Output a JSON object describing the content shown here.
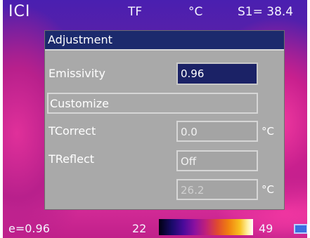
{
  "top_bar": {
    "brand": "ICI",
    "mode": "TF",
    "unit": "°C",
    "spot": "S1= 38.4"
  },
  "panel": {
    "title": "Adjustment",
    "emissivity": {
      "label": "Emissivity",
      "value": "0.96"
    },
    "customize": {
      "label": "Customize"
    },
    "tcorrect": {
      "label": "TCorrect",
      "value": "0.0",
      "unit": "°C"
    },
    "treflect": {
      "label": "TReflect",
      "value": "Off",
      "temp_value": "26.2",
      "unit": "°C"
    }
  },
  "bottom_bar": {
    "emissivity": "e=0.96",
    "scale_min": "22",
    "scale_max": "49",
    "battery_icon": "battery-icon"
  },
  "colors": {
    "header_bg": "#1c2a6d",
    "panel_bg": "#a9a9a9",
    "active_field": "#1b2266"
  }
}
